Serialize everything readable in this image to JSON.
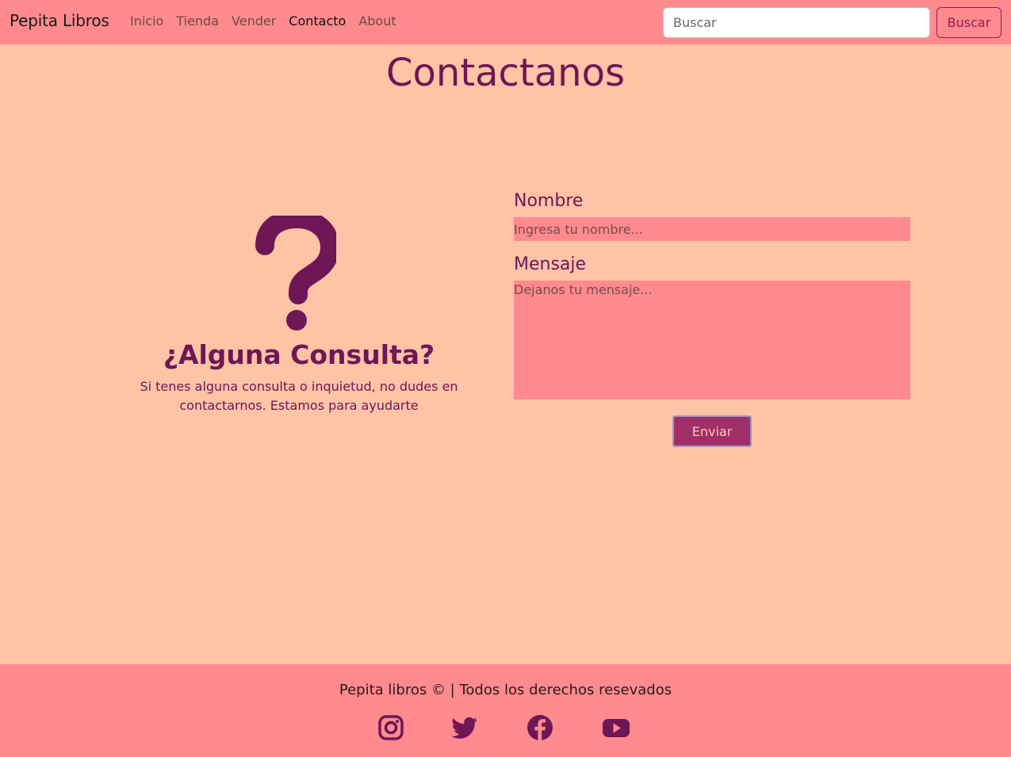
{
  "navbar": {
    "brand": "Pepita Libros",
    "links": [
      "Inicio",
      "Tienda",
      "Vender",
      "Contacto",
      "About"
    ],
    "active": "Contacto",
    "search_placeholder": "Buscar",
    "search_button": "Buscar"
  },
  "main": {
    "title": "Contactanos",
    "consult_title": "¿Alguna Consulta?",
    "consult_text": "Si tenes alguna consulta o inquietud, no dudes en contactarnos. Estamos para ayudarte",
    "form": {
      "name_label": "Nombre",
      "name_placeholder": "Ingresa tu nombre...",
      "message_label": "Mensaje",
      "message_placeholder": "Dejanos tu mensaje...",
      "submit_label": "Enviar"
    }
  },
  "footer": {
    "text": "Pepita libros © | Todos los derechos resevados",
    "social_icons": [
      "instagram-icon",
      "twitter-icon",
      "facebook-icon",
      "youtube-icon"
    ]
  },
  "colors": {
    "background": "#ffc3a6",
    "navbar": "#ff8b8e",
    "accent": "#6e1656",
    "button": "#a02f6a"
  }
}
